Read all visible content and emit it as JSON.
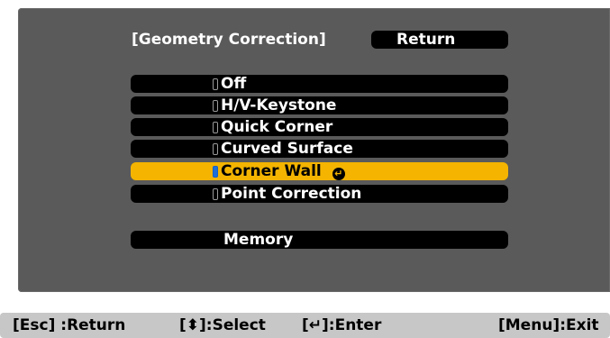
{
  "menu": {
    "title": "[Geometry Correction]",
    "return_label": "Return",
    "options": [
      {
        "label": "Off"
      },
      {
        "label": "H/V-Keystone"
      },
      {
        "label": "Quick Corner"
      },
      {
        "label": "Curved Surface"
      },
      {
        "label": "Corner Wall"
      },
      {
        "label": "Point Correction"
      }
    ],
    "selected_option": "Corner Wall",
    "enter_icon": "enter-icon",
    "memory_label": "Memory"
  },
  "footer": {
    "esc": "[Esc] :Return",
    "select": "[⬍]:Select",
    "enter": "[↵]:Enter",
    "menu": "[Menu]:Exit"
  },
  "colors": {
    "panel_bg": "#5a5a5a",
    "button_bg": "#000000",
    "highlight": "#f4b400",
    "radio_selected": "#1e6fd8",
    "footer_bg": "#c7c7c7"
  }
}
